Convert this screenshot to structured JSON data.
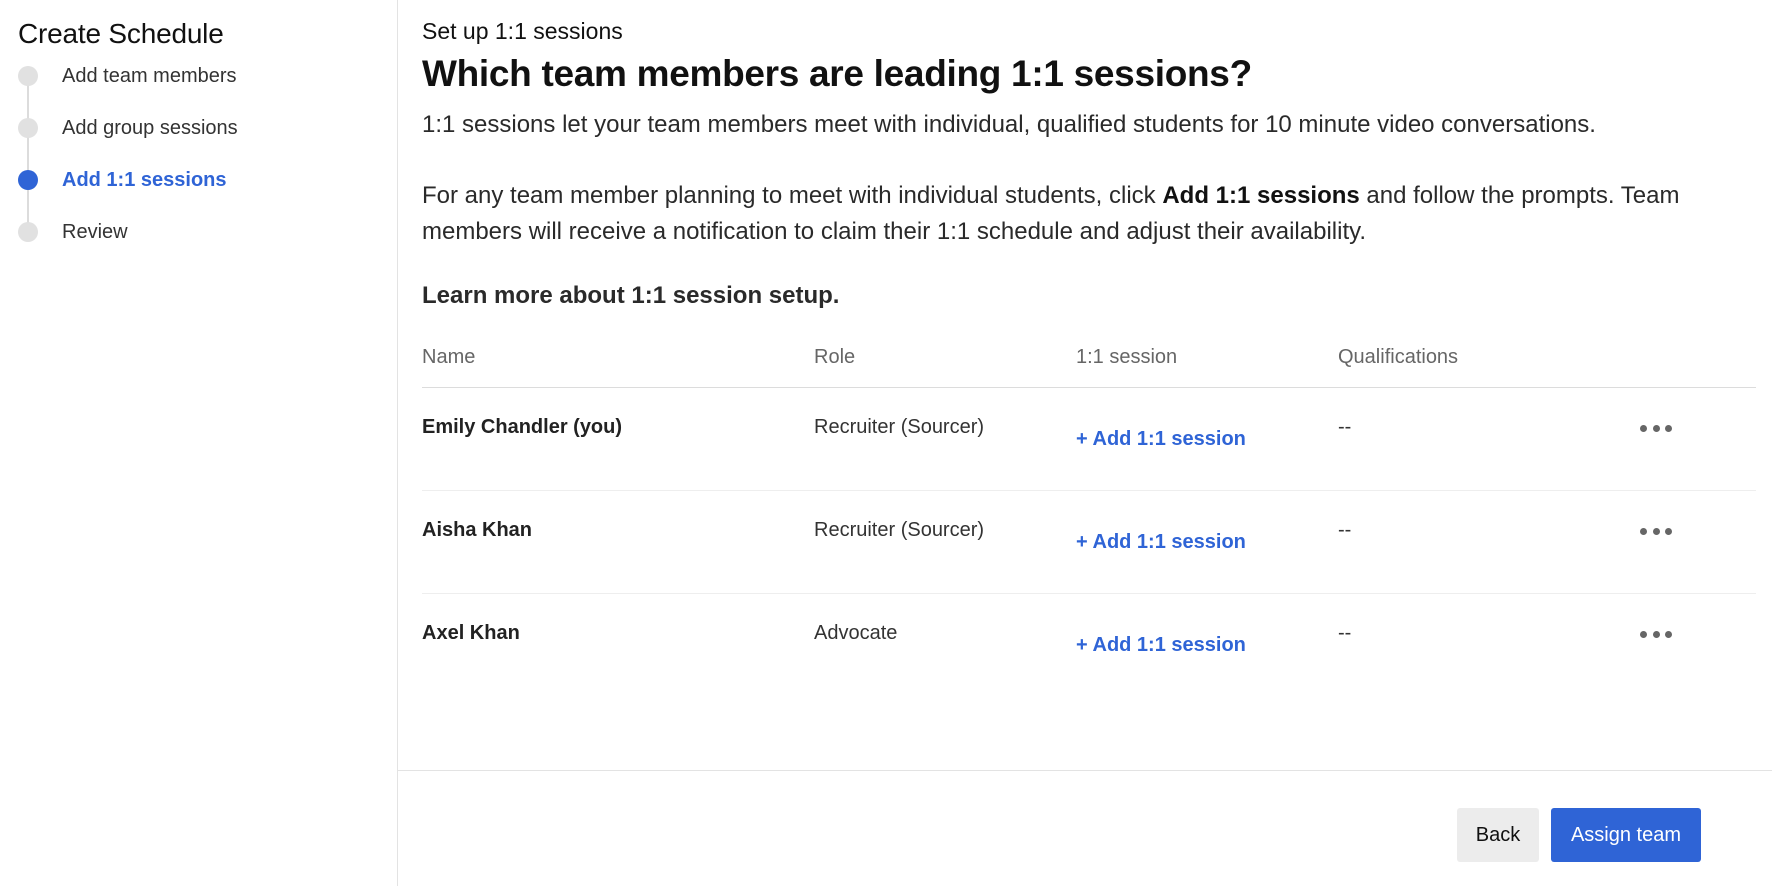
{
  "sidebar": {
    "title": "Create Schedule",
    "steps": [
      {
        "label": "Add team members",
        "active": false
      },
      {
        "label": "Add group sessions",
        "active": false
      },
      {
        "label": "Add 1:1 sessions",
        "active": true
      },
      {
        "label": "Review",
        "active": false
      }
    ]
  },
  "main": {
    "subtitle": "Set up 1:1 sessions",
    "heading": "Which team members are leading 1:1 sessions?",
    "intro": "1:1 sessions let your team members meet with individual, qualified students for 10 minute video conversations.",
    "instructions_pre": "For any team member planning to meet with individual students, click ",
    "instructions_bold": "Add 1:1 sessions",
    "instructions_post": " and follow the prompts. Team members will receive a notification to claim their 1:1 schedule and adjust their availability.",
    "learn_more": "Learn more about 1:1 session setup."
  },
  "table": {
    "headers": {
      "name": "Name",
      "role": "Role",
      "session": "1:1 session",
      "qualifications": "Qualifications"
    },
    "rows": [
      {
        "name": "Emily Chandler (you)",
        "role": "Recruiter (Sourcer)",
        "session_action": "+ Add 1:1 session",
        "qualifications": "--"
      },
      {
        "name": "Aisha Khan",
        "role": "Recruiter (Sourcer)",
        "session_action": "+ Add 1:1 session",
        "qualifications": "--"
      },
      {
        "name": "Axel Khan",
        "role": "Advocate",
        "session_action": "+ Add 1:1 session",
        "qualifications": "--"
      }
    ]
  },
  "footer": {
    "back_label": "Back",
    "assign_label": "Assign team"
  },
  "colors": {
    "accent": "#2f64d6",
    "step_inactive": "#e1e1e1",
    "secondary_button": "#ececec"
  }
}
